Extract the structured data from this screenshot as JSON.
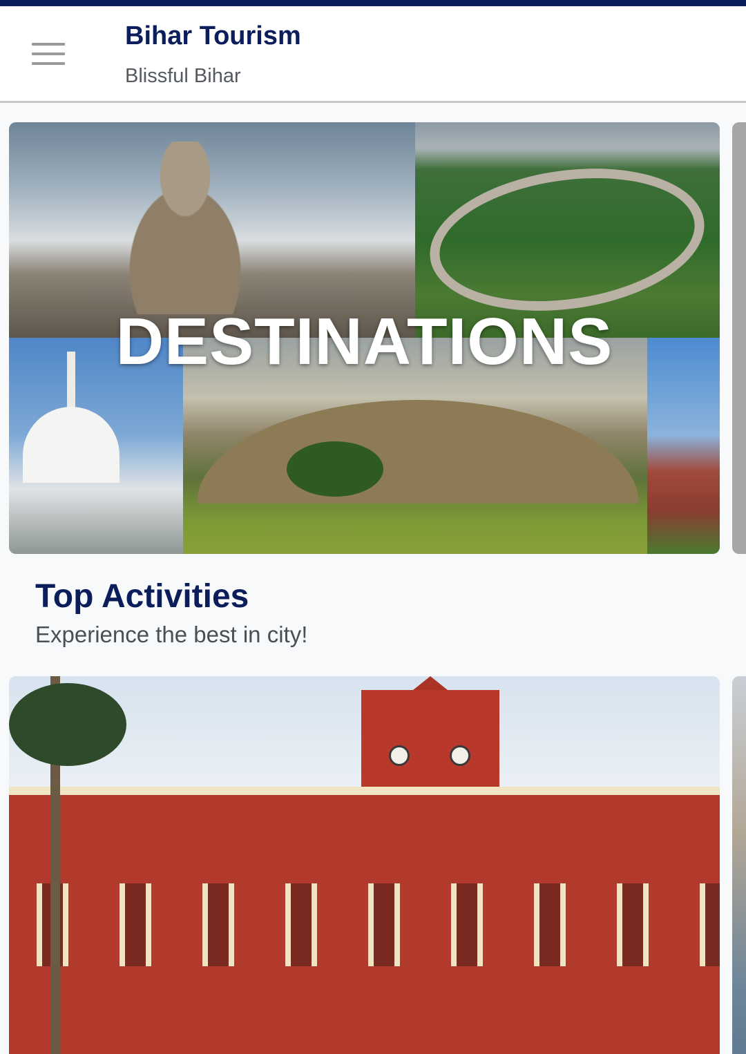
{
  "appbar": {
    "title": "Bihar Tourism",
    "subtitle": "Blissful Bihar",
    "menu_icon": "hamburger-menu-icon"
  },
  "destinations_card": {
    "label": "DESTINATIONS"
  },
  "top_activities": {
    "title": "Top Activities",
    "subtitle": "Experience the best in city!"
  },
  "colors": {
    "brand_navy": "#0b1e5b",
    "subtitle_gray": "#555a60",
    "background": "#f8f9fb"
  }
}
